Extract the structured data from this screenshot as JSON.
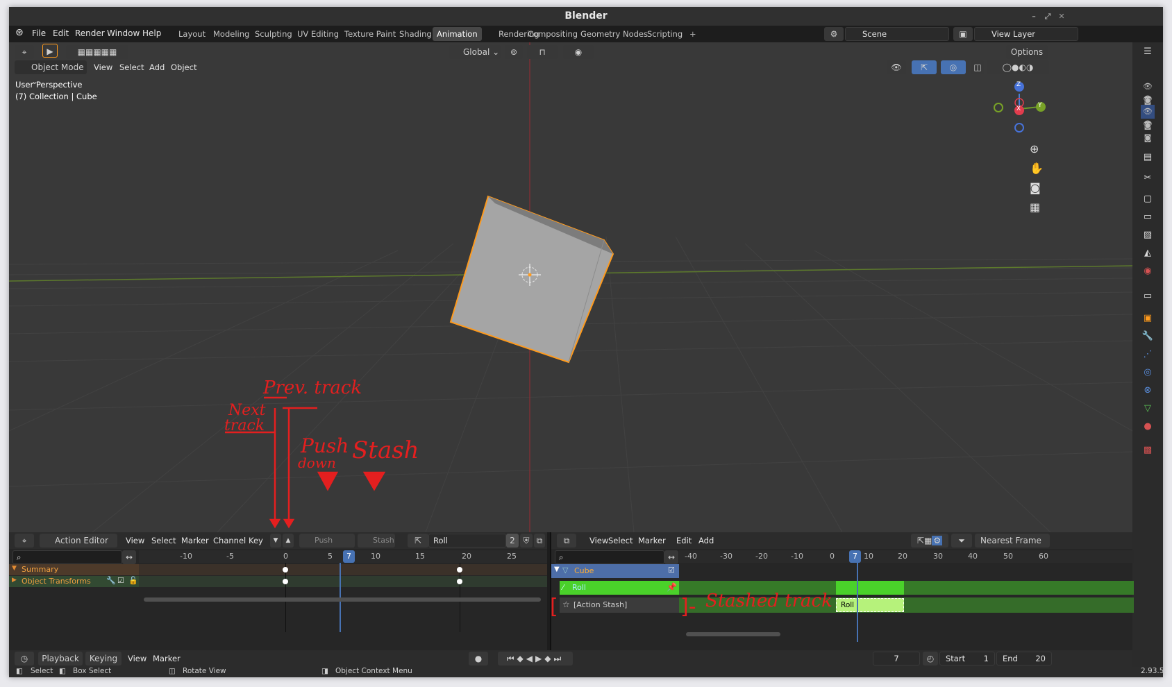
{
  "window": {
    "title": "Blender",
    "version": "2.93.5"
  },
  "menubar": {
    "menus": [
      "File",
      "Edit",
      "Render",
      "Window",
      "Help"
    ],
    "workspaces": [
      "Layout",
      "Modeling",
      "Sculpting",
      "UV Editing",
      "Texture Paint",
      "Shading",
      "Animation",
      "Rendering",
      "Compositing",
      "Geometry Nodes",
      "Scripting"
    ],
    "active_workspace": "Animation",
    "add_tab": "+",
    "scene": "Scene",
    "view_layer": "View Layer"
  },
  "viewport": {
    "orientation": "Global",
    "options_label": "Options",
    "mode": "Object Mode",
    "menus": [
      "View",
      "Select",
      "Add",
      "Object"
    ],
    "info_line1": "User Perspective",
    "info_line2": "(7) Collection | Cube",
    "gizmo": {
      "x": "X",
      "y": "Y",
      "z": "Z"
    }
  },
  "annotations": {
    "prev_track": "Prev. track",
    "next_track_1": "Next",
    "next_track_2": "track",
    "push_1": "Push",
    "push_2": "down",
    "stash": "Stash",
    "stashed_track": "Stashed track"
  },
  "action_editor": {
    "mode": "Action Editor",
    "menus": [
      "View",
      "Select",
      "Marker",
      "Channel",
      "Key"
    ],
    "push_down": "Push Down",
    "stash": "Stash",
    "action_name": "Roll",
    "user_count": "2",
    "ruler": [
      "-10",
      "-5",
      "0",
      "5",
      "7",
      "10",
      "15",
      "20",
      "25"
    ],
    "channels": [
      "Summary",
      "Object Transforms"
    ]
  },
  "nla_editor": {
    "menus": [
      "View",
      "Select",
      "Marker",
      "Edit",
      "Add"
    ],
    "snap": "Nearest Frame",
    "ruler": [
      "-40",
      "-30",
      "-20",
      "-10",
      "0",
      "7",
      "10",
      "20",
      "30",
      "40",
      "50",
      "60"
    ],
    "tracks": [
      "Cube",
      "Roll",
      "[Action Stash]"
    ],
    "strip_label": "Roll"
  },
  "timeline": {
    "menus": [
      "Playback",
      "Keying",
      "View",
      "Marker"
    ],
    "current_frame": "7",
    "start_label": "Start",
    "start": "1",
    "end_label": "End",
    "end": "20"
  },
  "statusbar": {
    "items": [
      "Select",
      "Box Select",
      "Rotate View",
      "Object Context Menu"
    ]
  },
  "colors": {
    "accent": "#4772b3",
    "selected": "#ff9a1c",
    "nla_green": "#4ad12a",
    "annotation": "#e41f1f"
  }
}
